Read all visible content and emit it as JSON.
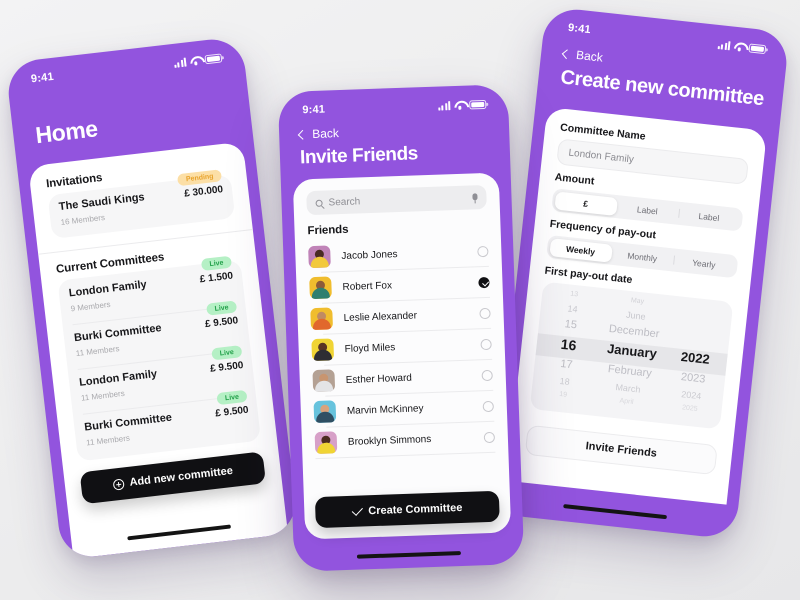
{
  "theme": {
    "brand_purple": "#9254DE",
    "background": "#efeff1",
    "dark_button": "#101013",
    "live_badge_bg": "#b5f0c5",
    "live_badge_text": "#22a14a",
    "pending_badge_bg": "#fcdfa6",
    "pending_badge_text": "#e8a32c"
  },
  "screens": {
    "home": {
      "status_time": "9:41",
      "title": "Home",
      "invitations": {
        "heading": "Invitations",
        "items": [
          {
            "name": "The Saudi Kings",
            "members": "16 Members",
            "amount": "£ 30.000",
            "badge": "Pending"
          }
        ]
      },
      "current": {
        "heading": "Current Committees",
        "items": [
          {
            "name": "London Family",
            "members": "9 Members",
            "amount": "£ 1.500",
            "badge": "Live"
          },
          {
            "name": "Burki Committee",
            "members": "11 Members",
            "amount": "£ 9.500",
            "badge": "Live"
          },
          {
            "name": "London Family",
            "members": "11 Members",
            "amount": "£ 9.500",
            "badge": "Live"
          },
          {
            "name": "Burki Committee",
            "members": "11 Members",
            "amount": "£ 9.500",
            "badge": "Live"
          }
        ]
      },
      "add_button": "Add new committee"
    },
    "invite": {
      "status_time": "9:41",
      "back_label": "Back",
      "title": "Invite Friends",
      "search_placeholder": "Search",
      "friends_heading": "Friends",
      "friends": [
        {
          "name": "Jacob Jones",
          "selected": false,
          "bg": "#c083b8",
          "skin": "#4a2b23",
          "shirt": "#f2c93c"
        },
        {
          "name": "Robert Fox",
          "selected": true,
          "bg": "#f0bd2e",
          "skin": "#8c5a3a",
          "shirt": "#2f7f6f"
        },
        {
          "name": "Leslie Alexander",
          "selected": false,
          "bg": "#f0bd2e",
          "skin": "#c08b63",
          "shirt": "#e1682c"
        },
        {
          "name": "Floyd Miles",
          "selected": false,
          "bg": "#f0d434",
          "skin": "#5b3524",
          "shirt": "#2e2e33"
        },
        {
          "name": "Esther Howard",
          "selected": false,
          "bg": "#b4a194",
          "skin": "#c89570",
          "shirt": "#e4e4e6"
        },
        {
          "name": "Marvin McKinney",
          "selected": false,
          "bg": "#67c3dd",
          "skin": "#d9a37c",
          "shirt": "#2f4f63"
        },
        {
          "name": "Brooklyn Simmons",
          "selected": false,
          "bg": "#d7a0c8",
          "skin": "#4b2c20",
          "shirt": "#f0d434"
        }
      ],
      "create_button": "Create Committee"
    },
    "create": {
      "status_time": "9:41",
      "back_label": "Back",
      "title": "Create new committee",
      "committee_name_label": "Committee Name",
      "committee_name_value": "London Family",
      "amount_label": "Amount",
      "amount_options": [
        "£",
        "Label",
        "Label"
      ],
      "amount_selected_index": 0,
      "frequency_label": "Frequency of pay-out",
      "frequency_options": [
        "Weekly",
        "Monthly",
        "Yearly"
      ],
      "frequency_selected_index": 0,
      "payout_date_label": "First pay-out date",
      "picker": {
        "days": [
          "13",
          "14",
          "15",
          "16",
          "17",
          "18",
          "19"
        ],
        "months": [
          "May",
          "June",
          "December",
          "January",
          "February",
          "March",
          "April"
        ],
        "years": [
          "",
          "",
          "",
          "2022",
          "2023",
          "2024",
          "2025"
        ],
        "selected_day": "16",
        "selected_month": "January",
        "selected_year": "2022",
        "selected_index": 3
      },
      "invite_button": "Invite Friends"
    }
  }
}
